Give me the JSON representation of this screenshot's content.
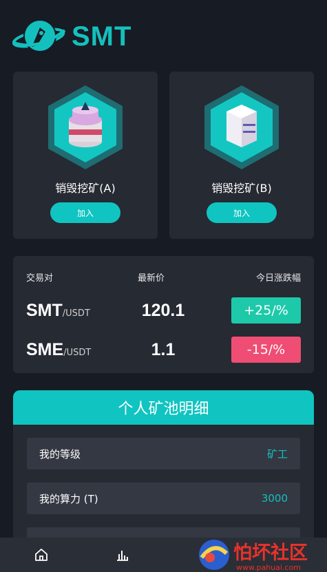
{
  "app": {
    "title": "SMT"
  },
  "mining": [
    {
      "label": "销毁挖矿(A)",
      "button": "加入"
    },
    {
      "label": "销毁挖矿(B)",
      "button": "加入"
    }
  ],
  "market": {
    "headers": {
      "pair": "交易对",
      "price": "最新价",
      "change": "今日涨跌幅"
    },
    "rows": [
      {
        "symbol": "SMT",
        "quote": "/USDT",
        "price": "120.1",
        "change": "+25/%",
        "color": "#1ec9aa"
      },
      {
        "symbol": "SME",
        "quote": "/USDT",
        "price": "1.1",
        "change": "-15/%",
        "color": "#f04d74"
      }
    ]
  },
  "pool": {
    "title": "个人矿池明细",
    "rows": [
      {
        "label": "我的等级",
        "value": "矿工"
      },
      {
        "label": "我的算力 (T)",
        "value": "3000"
      }
    ]
  },
  "watermark": {
    "text": "怕坏社区",
    "url": "www.pahuai.com"
  },
  "colors": {
    "accent": "#10c4c1",
    "background": "#171b24",
    "card": "#262a33"
  },
  "icons": {
    "tab_home": "home-icon",
    "tab_market": "chart-bars-icon"
  }
}
